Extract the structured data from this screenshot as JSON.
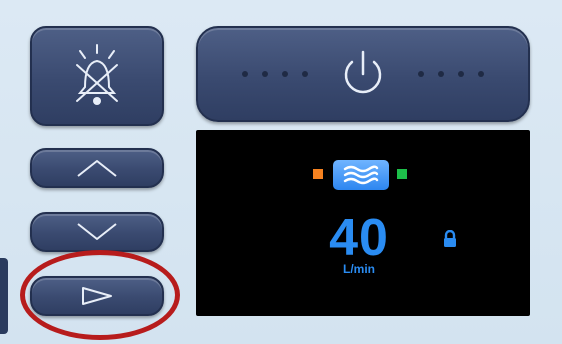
{
  "controls": {
    "alarm_silence": {
      "icon": "alarm-silence-bell-crossed-icon"
    },
    "power": {
      "icon": "power-icon",
      "indicator_dots": 8
    },
    "up": {
      "icon": "chevron-up-icon"
    },
    "down": {
      "icon": "chevron-down-icon"
    },
    "next": {
      "icon": "play-triangle-icon"
    }
  },
  "display": {
    "mode_icon": "humidifier-waves-icon",
    "left_indicator_color": "#f58220",
    "right_indicator_color": "#1dbf4a",
    "flow_value": "40",
    "flow_unit": "L/min",
    "lock_icon": "lock-icon",
    "value_color": "#2a8cf2"
  },
  "annotation": {
    "type": "circle-highlight",
    "color": "#b71c1c",
    "target": "next-button"
  }
}
